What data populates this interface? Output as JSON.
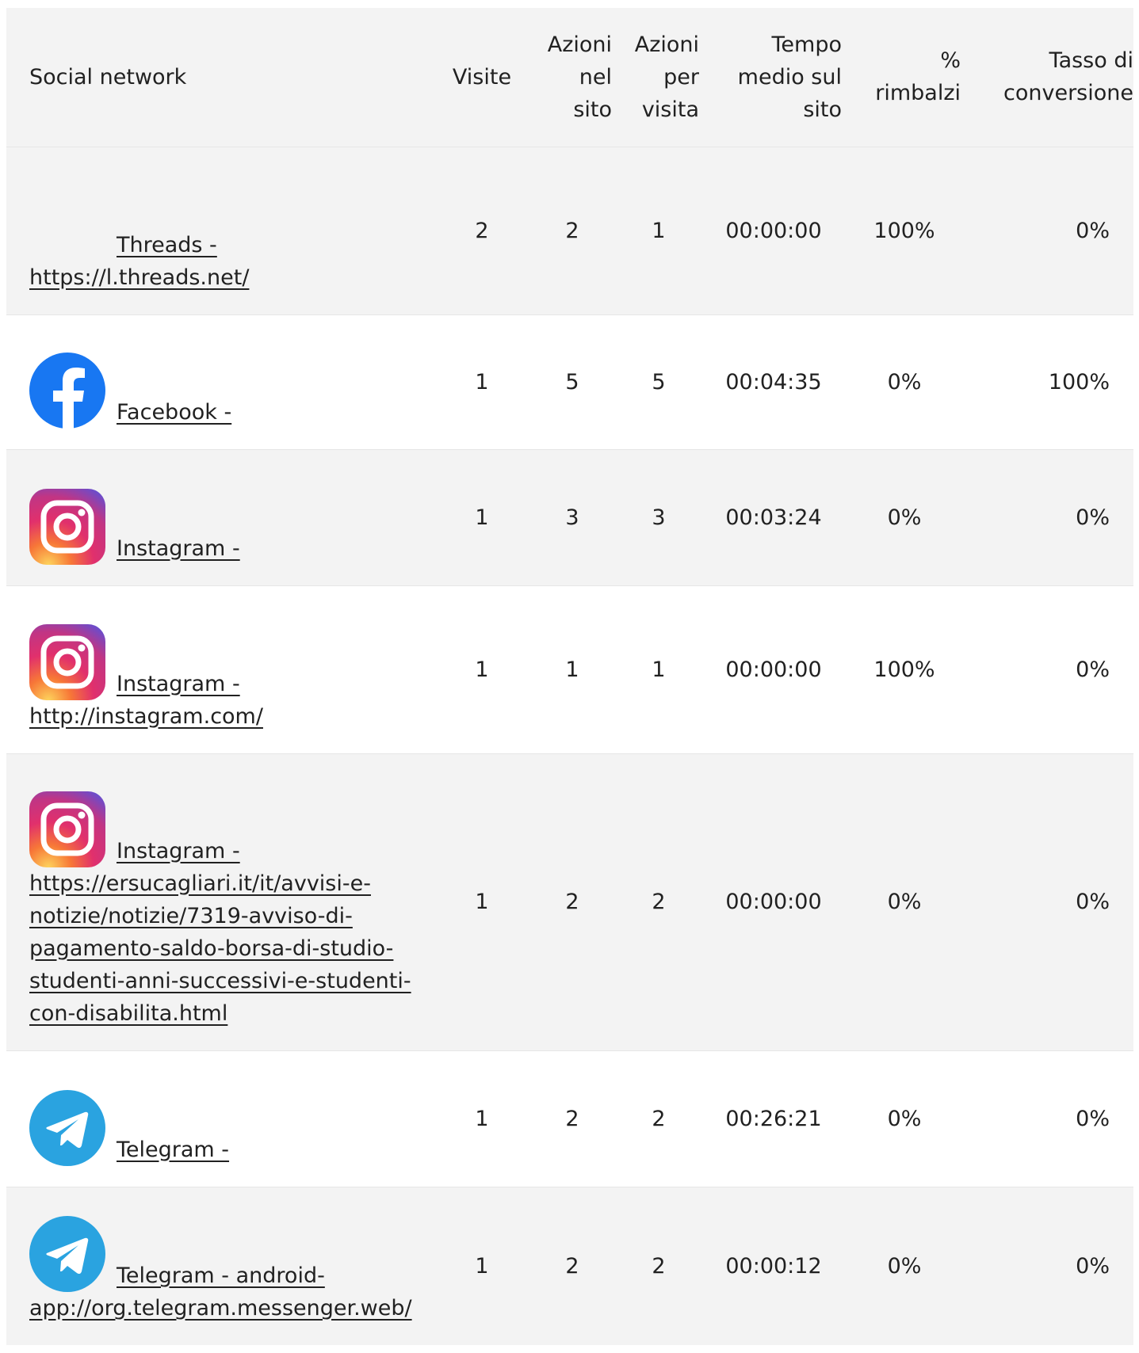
{
  "table": {
    "headers": {
      "social": "Social network",
      "visits": "Visite",
      "actions": "Azioni nel sito",
      "actions_per_visit": "Azioni per visita",
      "avg_time": "Tempo medio sul sito",
      "bounce": "% rimbalzi",
      "conversion": "Tasso di conversione"
    },
    "rows": [
      {
        "icon": "threads-icon",
        "label": "Threads - https://l.threads.net/",
        "visits": "2",
        "actions": "2",
        "apv": "1",
        "time": "00:00:00",
        "bounce": "100%",
        "conv": "0%"
      },
      {
        "icon": "facebook-icon",
        "label": "Facebook -",
        "visits": "1",
        "actions": "5",
        "apv": "5",
        "time": "00:04:35",
        "bounce": "0%",
        "conv": "100%"
      },
      {
        "icon": "instagram-icon",
        "label": "Instagram -",
        "visits": "1",
        "actions": "3",
        "apv": "3",
        "time": "00:03:24",
        "bounce": "0%",
        "conv": "0%"
      },
      {
        "icon": "instagram-icon",
        "label": "Instagram - http://instagram.com/",
        "visits": "1",
        "actions": "1",
        "apv": "1",
        "time": "00:00:00",
        "bounce": "100%",
        "conv": "0%"
      },
      {
        "icon": "instagram-icon",
        "label": "Instagram - https://ersucagliari.it/it/avvisi-e-notizie/notizie/7319-avviso-di-pagamento-saldo-borsa-di-studio-studenti-anni-successivi-e-studenti-con-disabilita.html",
        "visits": "1",
        "actions": "2",
        "apv": "2",
        "time": "00:00:00",
        "bounce": "0%",
        "conv": "0%"
      },
      {
        "icon": "telegram-icon",
        "label": "Telegram -",
        "visits": "1",
        "actions": "2",
        "apv": "2",
        "time": "00:26:21",
        "bounce": "0%",
        "conv": "0%"
      },
      {
        "icon": "telegram-icon",
        "label": "Telegram - android-app://org.telegram.messenger.web/",
        "visits": "1",
        "actions": "2",
        "apv": "2",
        "time": "00:00:12",
        "bounce": "0%",
        "conv": "0%"
      }
    ]
  },
  "colors": {
    "facebook": "#1877f2",
    "telegram": "#2aa3e0",
    "row_shade": "#f3f3f3"
  }
}
